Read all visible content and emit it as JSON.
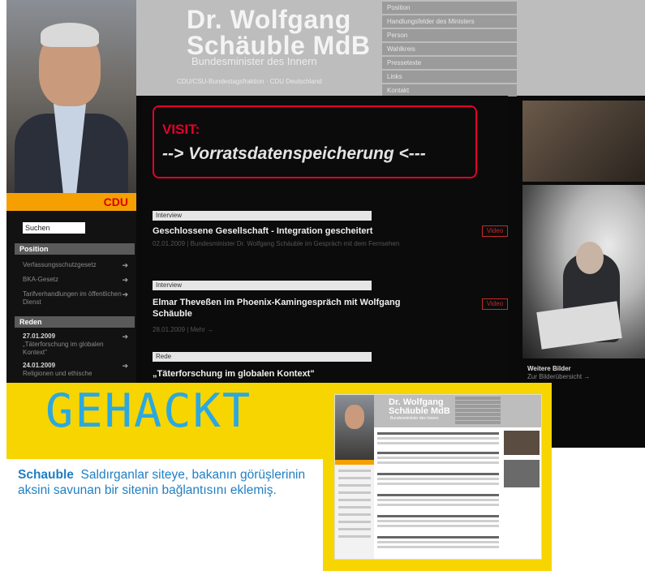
{
  "header": {
    "title_line1": "Dr. Wolfgang",
    "title_line2": "Schäuble  MdB",
    "subtitle": "Bundesminister des Innern",
    "links": "CDU/CSU-Bundestagsfraktion · CDU Deutschland"
  },
  "top_nav": [
    "Position",
    "Handlungsfelder des Ministers",
    "Person",
    "Wahlkreis",
    "Pressetexte",
    "Links",
    "Kontakt"
  ],
  "sidebar": {
    "logo": "CDU",
    "search_placeholder": "Suchen",
    "position_heading": "Position",
    "position_items": [
      {
        "text": "Verfassungsschutzgesetz"
      },
      {
        "text": "BKA-Gesetz"
      },
      {
        "text": "Tarifverhandlungen im öffentlichen Dienst"
      }
    ],
    "news_heading": "Reden",
    "news_items": [
      {
        "date": "27.01.2009",
        "text": "„Täterforschung im globalen Kontext\""
      },
      {
        "date": "24.01.2009",
        "text": "Religionen und ethische"
      }
    ]
  },
  "center": {
    "visit_label": "VISIT:",
    "visit_link": "--> Vorratsdatenspeicherung <---",
    "articles": [
      {
        "category": "Interview",
        "title": "Geschlossene Gesellschaft - Integration gescheitert",
        "meta": "02.01.2009 | Bundesminister Dr. Wolfgang Schäuble im Gespräch mit dem Fernsehen",
        "badge": "Video"
      },
      {
        "category": "Interview",
        "title": "Elmar Theveßen im Phoenix-Kamingespräch mit Wolfgang Schäuble",
        "meta": "28.01.2009 | Mehr →",
        "badge": "Video"
      },
      {
        "category": "Rede",
        "title": "„Täterforschung im globalen Kontext\"",
        "meta": "",
        "badge": ""
      }
    ]
  },
  "right": {
    "more_title": "Weitere Bilder",
    "more_link": "Zur Bilderübersicht →"
  },
  "overlay": {
    "headline": "GEHACKT",
    "caption_bold": "Schauble",
    "caption_text": "Saldırganlar siteye, bakanın görüşlerinin aksini savunan bir sitenin bağlantısını eklemiş."
  },
  "thumbnail": {
    "title_line1": "Dr. Wolfgang",
    "title_line2": "Schäuble  MdB",
    "subtitle": "Bundesminister des Innern"
  },
  "colors": {
    "accent_yellow": "#f6d500",
    "headline_blue": "#2ba8e0",
    "caption_blue": "#1f7fc4",
    "visit_red": "#e4002b",
    "cdu_orange": "#f5a000"
  }
}
